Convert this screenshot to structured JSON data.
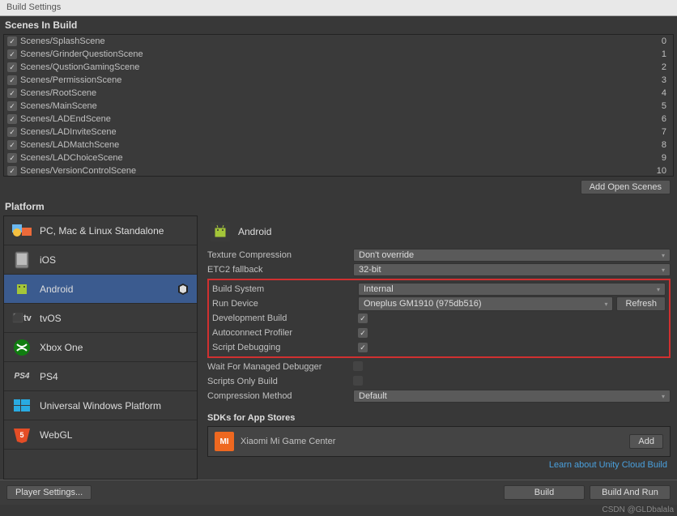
{
  "window": {
    "title": "Build Settings"
  },
  "scenes_header": "Scenes In Build",
  "scenes": [
    {
      "name": "Scenes/SplashScene",
      "idx": "0",
      "checked": true
    },
    {
      "name": "Scenes/GrinderQuestionScene",
      "idx": "1",
      "checked": true
    },
    {
      "name": "Scenes/QustionGamingScene",
      "idx": "2",
      "checked": true
    },
    {
      "name": "Scenes/PermissionScene",
      "idx": "3",
      "checked": true
    },
    {
      "name": "Scenes/RootScene",
      "idx": "4",
      "checked": true
    },
    {
      "name": "Scenes/MainScene",
      "idx": "5",
      "checked": true
    },
    {
      "name": "Scenes/LADEndScene",
      "idx": "6",
      "checked": true
    },
    {
      "name": "Scenes/LADInviteScene",
      "idx": "7",
      "checked": true
    },
    {
      "name": "Scenes/LADMatchScene",
      "idx": "8",
      "checked": true
    },
    {
      "name": "Scenes/LADChoiceScene",
      "idx": "9",
      "checked": true
    },
    {
      "name": "Scenes/VersionControlScene",
      "idx": "10",
      "checked": true
    }
  ],
  "add_open_scenes": "Add Open Scenes",
  "platform_header": "Platform",
  "platforms": [
    {
      "label": "PC, Mac & Linux Standalone"
    },
    {
      "label": "iOS"
    },
    {
      "label": "Android",
      "selected": true
    },
    {
      "label": "tvOS"
    },
    {
      "label": "Xbox One"
    },
    {
      "label": "PS4"
    },
    {
      "label": "Universal Windows Platform"
    },
    {
      "label": "WebGL"
    }
  ],
  "detail": {
    "title": "Android",
    "texture_compression": {
      "label": "Texture Compression",
      "value": "Don't override"
    },
    "etc2": {
      "label": "ETC2 fallback",
      "value": "32-bit"
    },
    "build_system": {
      "label": "Build System",
      "value": "Internal"
    },
    "run_device": {
      "label": "Run Device",
      "value": "Oneplus GM1910 (975db516)",
      "refresh": "Refresh"
    },
    "dev_build": {
      "label": "Development Build",
      "checked": true
    },
    "autoconnect": {
      "label": "Autoconnect Profiler",
      "checked": true
    },
    "script_debug": {
      "label": "Script Debugging",
      "checked": true
    },
    "wait_debugger": {
      "label": "Wait For Managed Debugger",
      "checked": false
    },
    "scripts_only": {
      "label": "Scripts Only Build",
      "checked": false
    },
    "compression": {
      "label": "Compression Method",
      "value": "Default"
    }
  },
  "sdk": {
    "header": "SDKs for App Stores",
    "item": "Xiaomi Mi Game Center",
    "add": "Add"
  },
  "cloud_link": "Learn about Unity Cloud Build",
  "footer": {
    "player_settings": "Player Settings...",
    "build": "Build",
    "build_run": "Build And Run"
  },
  "watermark": "CSDN @GLDbalala"
}
